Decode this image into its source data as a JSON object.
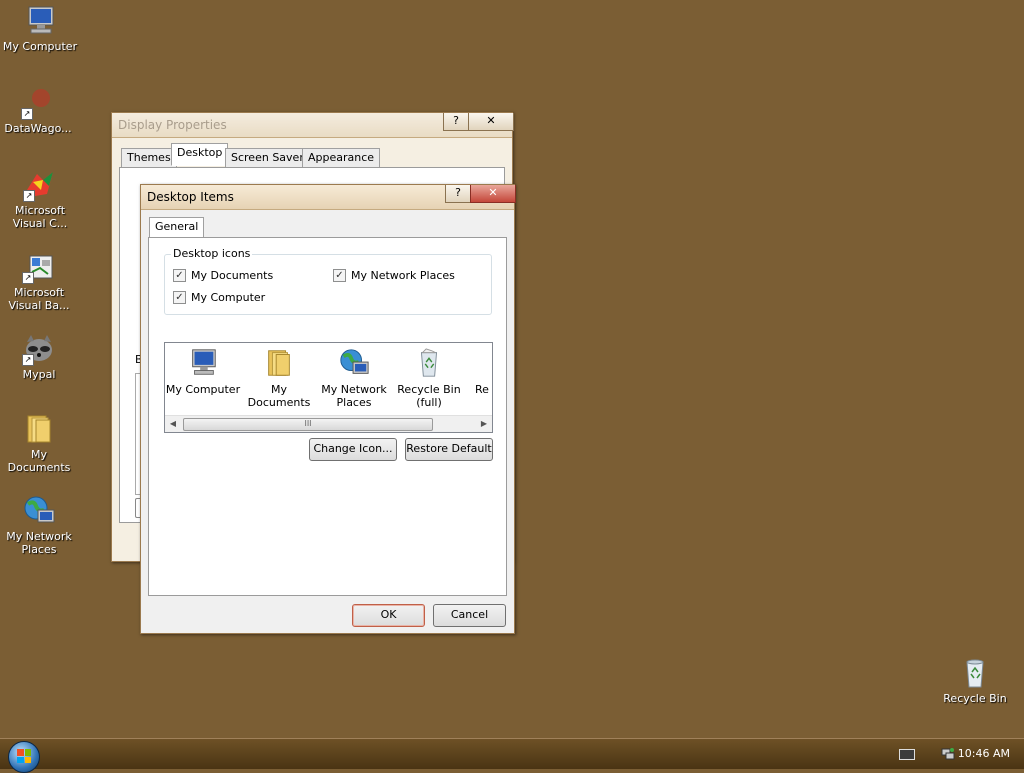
{
  "desktop": {
    "icons": [
      {
        "label": "My Computer"
      },
      {
        "label": "DataWago..."
      },
      {
        "label": "Microsoft Visual C..."
      },
      {
        "label": "Microsoft Visual Ba..."
      },
      {
        "label": "Mypal"
      },
      {
        "label": "My Documents"
      },
      {
        "label": "My Network Places"
      },
      {
        "label": "Recycle Bin"
      }
    ]
  },
  "display_properties": {
    "title": "Display Properties",
    "help_label": "?",
    "close_label": "✕",
    "tabs": [
      "Themes",
      "Desktop",
      "Screen Saver",
      "Appearance"
    ],
    "partial_label": "B"
  },
  "desktop_items": {
    "title": "Desktop Items",
    "help_label": "?",
    "close_label": "✕",
    "tab": "General",
    "group_title": "Desktop icons",
    "checkboxes": [
      {
        "label": "My Documents",
        "checked": true
      },
      {
        "label": "My Network Places",
        "checked": true
      },
      {
        "label": "My Computer",
        "checked": true
      }
    ],
    "list_items": [
      {
        "label": "My Computer",
        "icon": "computer-icon"
      },
      {
        "label": "My Documents",
        "icon": "folder-icon"
      },
      {
        "label": "My Network Places",
        "icon": "network-globe-icon"
      },
      {
        "label": "Recycle Bin (full)",
        "icon": "recycle-bin-full-icon"
      },
      {
        "label": "Re (",
        "icon": "recycle-bin-empty-icon"
      }
    ],
    "scroll_grip": "III",
    "change_icon_label": "Change Icon...",
    "restore_default_label": "Restore Default",
    "ok_label": "OK",
    "cancel_label": "Cancel"
  },
  "taskbar": {
    "clock": "10:46 AM"
  },
  "colors": {
    "desktop_background": "#7b5e34",
    "taskbar": "#5a4018"
  }
}
